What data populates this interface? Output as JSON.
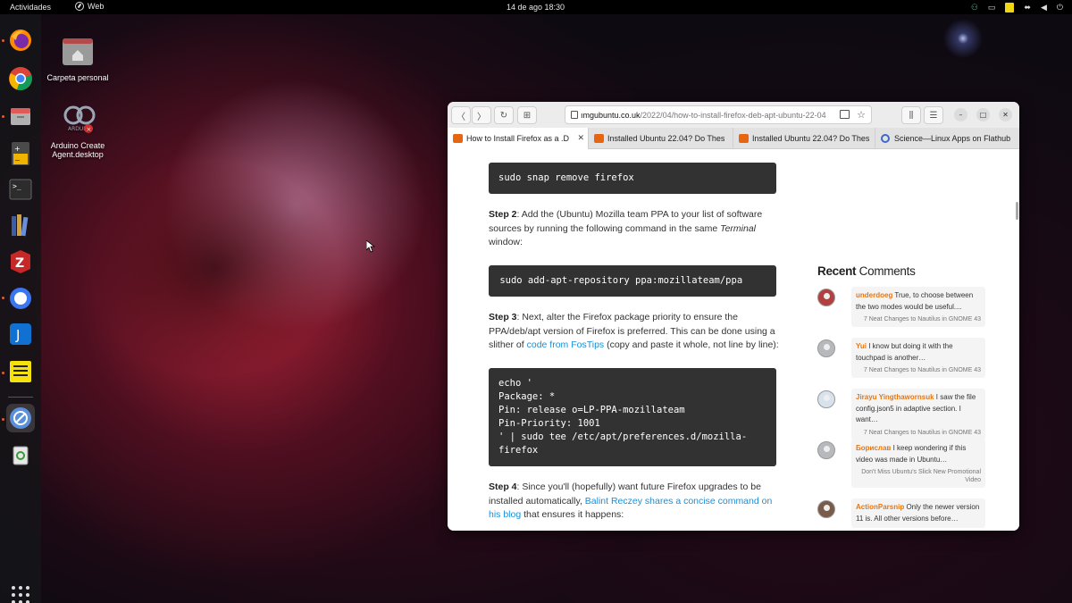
{
  "topbar": {
    "activities": "Actividades",
    "app_name": "Web",
    "clock": "14 de ago  18:30"
  },
  "dock": {
    "items": [
      "firefox-icon",
      "chrome-icon",
      "files-icon",
      "calculator-icon",
      "terminal-icon",
      "calibre-icon",
      "zotero-icon",
      "signal-icon",
      "joplin-icon",
      "notes-icon",
      "web-browser-icon",
      "trash-icon"
    ]
  },
  "desktop": {
    "home_label": "Carpeta personal",
    "arduino_label": "Arduino Create Agent.desktop"
  },
  "browser": {
    "url_host": "ımgubuntu.co.uk",
    "url_path": "/2022/04/how-to-install-firefox-deb-apt-ubuntu-22-04",
    "tabs": [
      "How to Install Firefox as a .D",
      "Installed Ubuntu 22.04? Do Thes",
      "Installed Ubuntu 22.04? Do Thes",
      "Science—Linux Apps on Flathub"
    ]
  },
  "article": {
    "code1": "sudo snap remove firefox",
    "step2_label": "Step 2",
    "step2_text1": ": Add the (Ubuntu) Mozilla team PPA to your list of software sources by running the following command in the same ",
    "step2_italic": "Terminal",
    "step2_text2": " window:",
    "code2": " sudo add-apt-repository ppa:mozillateam/ppa",
    "step3_label": "Step 3",
    "step3_text1": ": Next, alter the Firefox package priority to ensure the PPA/deb/apt version of Firefox is preferred. This can be done using a slither of ",
    "step3_link": "code from FosTips",
    "step3_text2": " (copy and paste it whole, not line by line):",
    "code3": "echo '\nPackage: *\nPin: release o=LP-PPA-mozillateam\nPin-Priority: 1001\n' | sudo tee /etc/apt/preferences.d/mozilla-\nfirefox",
    "step4_label": "Step 4",
    "step4_text1": ": Since you'll (hopefully) want future Firefox upgrades to be installed automatically, ",
    "step4_link": "Balint Reczey shares a concise command on his blog",
    "step4_text2": " that ensures it happens:"
  },
  "sidebar": {
    "title_bold": "Recent",
    "title_rest": " Comments",
    "comments": [
      {
        "name": "underdoeg",
        "text": " True, to choose between the two modes would be useful....",
        "post": "7 Neat Changes to Nautilus in GNOME 43"
      },
      {
        "name": "Yui",
        "text": " I know but doing it with the touchpad is another…",
        "post": "7 Neat Changes to Nautilus in GNOME 43"
      },
      {
        "name": "Jirayu Yingthawornsuk",
        "text": " I saw the file config.json5 in adaptive section. I want…",
        "post": "7 Neat Changes to Nautilus in GNOME 43"
      },
      {
        "name": "Борислав",
        "text": " I keep wondering if this video was made in Ubuntu…",
        "post": "Don't Miss Ubuntu's Slick New Promotional Video"
      },
      {
        "name": "ActionParsnip",
        "text": " Only the newer version 11 is. All other versions before…",
        "post": ""
      }
    ]
  },
  "colors": {
    "accent_orange": "#e8760f",
    "link_blue": "#1a8fd8",
    "code_bg": "#323232"
  }
}
